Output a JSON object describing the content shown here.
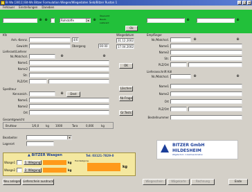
{
  "window": {
    "title": "Bi Wa   [2811] Bit-Ws Bitzer Formulation  Wiegen/Wiegedaten  Sieb/Bitzer  Ruston 1"
  },
  "menu": [
    "Fehlauer",
    "Einstellungen",
    "Daneben"
  ],
  "green": {
    "dropdown_value": "Rohstoffe",
    "info_line1": "Übersicht",
    "info_line2": "Bearb.",
    "info_line3": "Lieferant",
    "ok_label": "Ok"
  },
  "left": {
    "section_top": "Kfz",
    "field_labels": [
      "Anh.-Kennz.",
      "Gewicht"
    ],
    "uebergang_label": "Übergang",
    "uebergang_value": "00:00",
    "datum_value": "4/0",
    "section_lieferant": "Lieferant/Lieferer",
    "lieferant_labels": [
      "Nr./Matchcd.",
      "Name1",
      "Name2",
      "Str.",
      "PLZ/Ort"
    ],
    "section_spediteur": "Spediteur",
    "spediteur_labels": [
      "Kennzeich.",
      "Name1",
      "Name2",
      "Ort"
    ],
    "spediteur_button": "Dest",
    "section_gewicht": "Gesamtgewicht",
    "gewicht_row": [
      "Bruttow",
      "1/0,0",
      "kg",
      "1000",
      "Tara",
      "0,000",
      "kg"
    ],
    "bemerkung_label": "Bearbeiter",
    "lagerort_label": "Lagerort"
  },
  "middle": {
    "wiegedatum_label": "Wiegedatum",
    "date1": "31.12.2002",
    "date2": "17.04.2002",
    "btn_ok": "OK",
    "btn_loeschen": "Löschen",
    "btn_ablehnen": "Ab-Frage",
    "btn_tests": "Gr.Tests"
  },
  "right": {
    "section_top": "Empfänger",
    "top_labels": [
      "Nr./Matchcd.",
      "Name1",
      "Name2",
      "Str.",
      "PLZ/Ort"
    ],
    "section_lieferanschrift": "Lieferanschrift Kdl",
    "lief_labels": [
      "Nr./Matchcd.",
      "Name1",
      "Name2",
      "Ort",
      "PLZ/Ort"
    ],
    "bestellung_label": "Bestellnummer"
  },
  "scale": {
    "brand": "BITZER Waagen",
    "tel": "Tel: 03121-7829-0",
    "waage1_label": "Waage1",
    "waage1_btn": "1. Wiegung",
    "waage1_value": "0",
    "waage1_unit": "kg",
    "waage1_mode": "Handwägung",
    "waage2_label": "Waage2",
    "waage2_btn": "2. Wiegung",
    "waage2_value": "0",
    "waage2_unit": "kg",
    "netto_value": "0",
    "netto_unit": "kg"
  },
  "company_logo": {
    "line1": "BITZER GmbH",
    "line2": "HILDESHEIM",
    "line3": "Wägetechnik · Industrieautomation"
  },
  "footer": {
    "buttons": [
      "Neu anlegen",
      "Lieferschein ausdrucken",
      "Wiegeschein",
      "Wägekarte",
      "Rechnung",
      "Ende"
    ]
  },
  "colors": {
    "green": "#22c03a",
    "scale_bg": "#f4e8a0",
    "value_orange": "#ff9a1a",
    "title_blue": "#1c3f9a"
  }
}
